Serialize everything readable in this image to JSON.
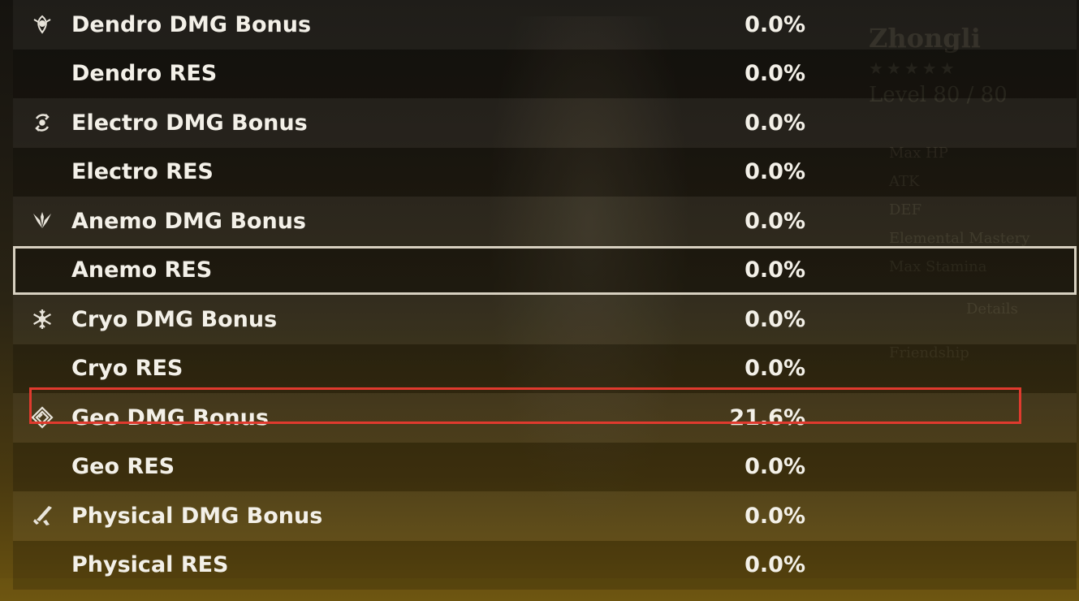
{
  "background": {
    "character_name": "Zhongli",
    "stars": "★★★★★",
    "level": "Level 80 / 80",
    "stats": [
      "Max HP",
      "ATK",
      "DEF",
      "Elemental Mastery",
      "Max Stamina",
      "Details",
      "Friendship"
    ]
  },
  "rows": [
    {
      "icon": "dendro-icon",
      "label": "Dendro DMG Bonus",
      "value": "0.0%"
    },
    {
      "icon": "",
      "label": "Dendro RES",
      "value": "0.0%"
    },
    {
      "icon": "electro-icon",
      "label": "Electro DMG Bonus",
      "value": "0.0%"
    },
    {
      "icon": "",
      "label": "Electro RES",
      "value": "0.0%"
    },
    {
      "icon": "anemo-icon",
      "label": "Anemo DMG Bonus",
      "value": "0.0%"
    },
    {
      "icon": "",
      "label": "Anemo RES",
      "value": "0.0%"
    },
    {
      "icon": "cryo-icon",
      "label": "Cryo DMG Bonus",
      "value": "0.0%"
    },
    {
      "icon": "",
      "label": "Cryo RES",
      "value": "0.0%"
    },
    {
      "icon": "geo-icon",
      "label": "Geo DMG Bonus",
      "value": "21.6%"
    },
    {
      "icon": "",
      "label": "Geo RES",
      "value": "0.0%"
    },
    {
      "icon": "physical-icon",
      "label": "Physical DMG Bonus",
      "value": "0.0%"
    },
    {
      "icon": "",
      "label": "Physical RES",
      "value": "0.0%"
    }
  ],
  "colors": {
    "text": "#f3f0e8",
    "selection_outline": "#d7d0c0",
    "annotation_red": "#e03a2e"
  }
}
